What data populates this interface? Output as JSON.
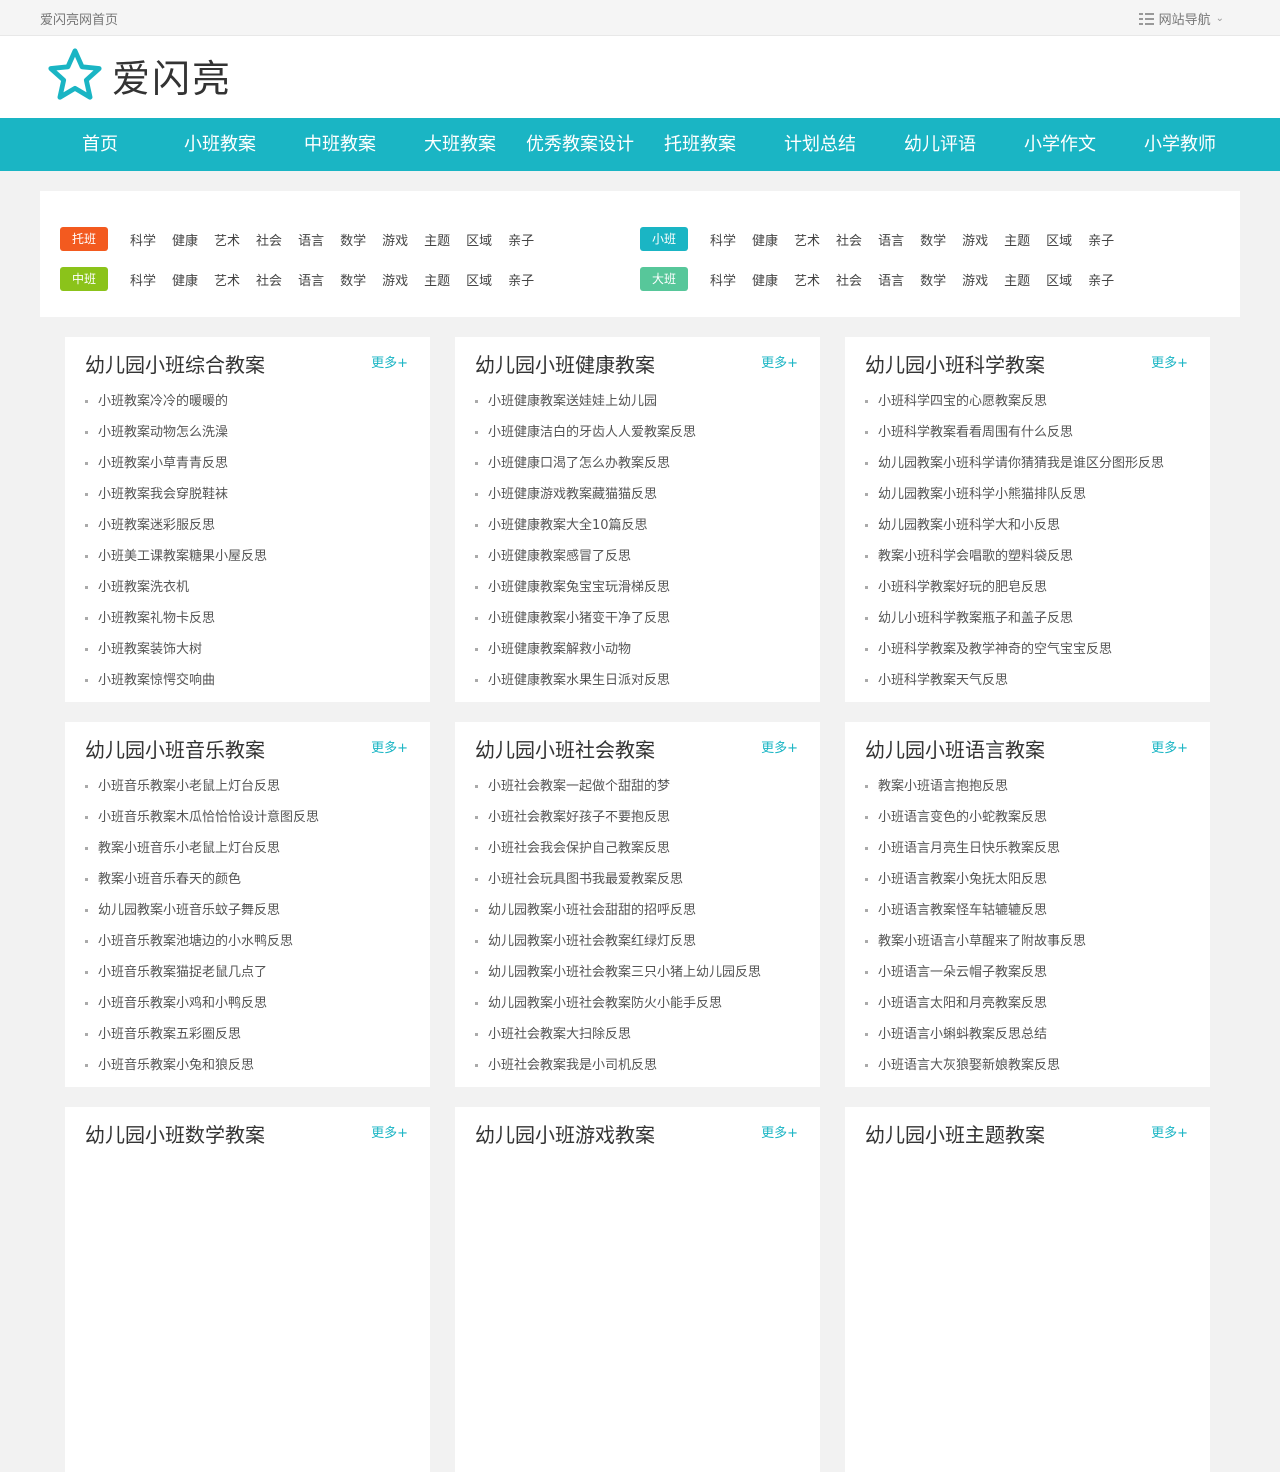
{
  "topbar": {
    "home_link": "爱闪亮网首页",
    "site_nav": "网站导航"
  },
  "logo": {
    "brand": "爱闪亮",
    "accent": "#1ab5c4"
  },
  "nav": [
    "首页",
    "小班教案",
    "中班教案",
    "大班教案",
    "优秀教案设计",
    "托班教案",
    "计划总结",
    "幼儿评语",
    "小学作文",
    "小学教师"
  ],
  "filters": [
    {
      "label": "托班",
      "color": "#f35a1f",
      "subjects": [
        "科学",
        "健康",
        "艺术",
        "社会",
        "语言",
        "数学",
        "游戏",
        "主题",
        "区域",
        "亲子"
      ]
    },
    {
      "label": "小班",
      "color": "#1ab5c4",
      "subjects": [
        "科学",
        "健康",
        "艺术",
        "社会",
        "语言",
        "数学",
        "游戏",
        "主题",
        "区域",
        "亲子"
      ]
    },
    {
      "label": "中班",
      "color": "#8bc31a",
      "subjects": [
        "科学",
        "健康",
        "艺术",
        "社会",
        "语言",
        "数学",
        "游戏",
        "主题",
        "区域",
        "亲子"
      ]
    },
    {
      "label": "大班",
      "color": "#57c79a",
      "subjects": [
        "科学",
        "健康",
        "艺术",
        "社会",
        "语言",
        "数学",
        "游戏",
        "主题",
        "区域",
        "亲子"
      ]
    }
  ],
  "more_label": "更多+",
  "cards": [
    {
      "title": "幼儿园小班综合教案",
      "items": [
        "小班教案冷冷的暖暖的",
        "小班教案动物怎么洗澡",
        "小班教案小草青青反思",
        "小班教案我会穿脱鞋袜",
        "小班教案迷彩服反思",
        "小班美工课教案糖果小屋反思",
        "小班教案洗衣机",
        "小班教案礼物卡反思",
        "小班教案装饰大树",
        "小班教案惊愕交响曲"
      ]
    },
    {
      "title": "幼儿园小班健康教案",
      "items": [
        "小班健康教案送娃娃上幼儿园",
        "小班健康洁白的牙齿人人爱教案反思",
        "小班健康口渴了怎么办教案反思",
        "小班健康游戏教案藏猫猫反思",
        "小班健康教案大全10篇反思",
        "小班健康教案感冒了反思",
        "小班健康教案兔宝宝玩滑梯反思",
        "小班健康教案小猪变干净了反思",
        "小班健康教案解救小动物",
        "小班健康教案水果生日派对反思"
      ]
    },
    {
      "title": "幼儿园小班科学教案",
      "items": [
        "小班科学四宝的心愿教案反思",
        "小班科学教案看看周围有什么反思",
        "幼儿园教案小班科学请你猜猜我是谁区分图形反思",
        "幼儿园教案小班科学小熊猫排队反思",
        "幼儿园教案小班科学大和小反思",
        "教案小班科学会唱歌的塑料袋反思",
        "小班科学教案好玩的肥皂反思",
        "幼儿小班科学教案瓶子和盖子反思",
        "小班科学教案及教学神奇的空气宝宝反思",
        "小班科学教案天气反思"
      ]
    },
    {
      "title": "幼儿园小班音乐教案",
      "items": [
        "小班音乐教案小老鼠上灯台反思",
        "小班音乐教案木瓜恰恰恰设计意图反思",
        "教案小班音乐小老鼠上灯台反思",
        "教案小班音乐春天的颜色",
        "幼儿园教案小班音乐蚊子舞反思",
        "小班音乐教案池塘边的小水鸭反思",
        "小班音乐教案猫捉老鼠几点了",
        "小班音乐教案小鸡和小鸭反思",
        "小班音乐教案五彩圈反思",
        "小班音乐教案小兔和狼反思"
      ]
    },
    {
      "title": "幼儿园小班社会教案",
      "items": [
        "小班社会教案一起做个甜甜的梦",
        "小班社会教案好孩子不要抱反思",
        "小班社会我会保护自己教案反思",
        "小班社会玩具图书我最爱教案反思",
        "幼儿园教案小班社会甜甜的招呼反思",
        "幼儿园教案小班社会教案红绿灯反思",
        "幼儿园教案小班社会教案三只小猪上幼儿园反思",
        "幼儿园教案小班社会教案防火小能手反思",
        "小班社会教案大扫除反思",
        "小班社会教案我是小司机反思"
      ]
    },
    {
      "title": "幼儿园小班语言教案",
      "items": [
        "教案小班语言抱抱反思",
        "小班语言变色的小蛇教案反思",
        "小班语言月亮生日快乐教案反思",
        "小班语言教案小兔抚太阳反思",
        "小班语言教案怪车轱辘辘反思",
        "教案小班语言小草醒来了附故事反思",
        "小班语言一朵云帽子教案反思",
        "小班语言太阳和月亮教案反思",
        "小班语言小蝌蚪教案反思总结",
        "小班语言大灰狼娶新娘教案反思"
      ]
    },
    {
      "title": "幼儿园小班数学教案",
      "items": []
    },
    {
      "title": "幼儿园小班游戏教案",
      "items": []
    },
    {
      "title": "幼儿园小班主题教案",
      "items": []
    }
  ]
}
